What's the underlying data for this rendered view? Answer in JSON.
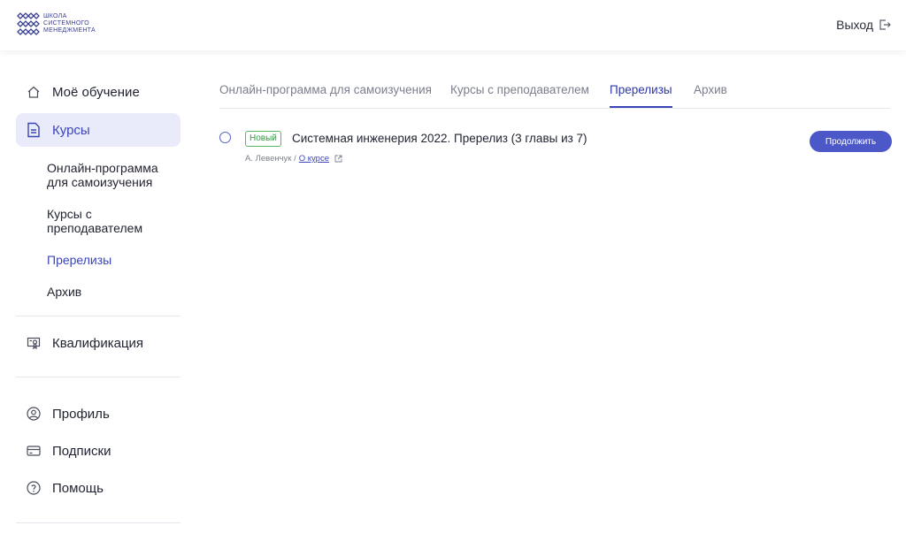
{
  "header": {
    "logo_text": "ШКОЛА\nСИСТЕМНОГО\nМЕНЕДЖМЕНТА",
    "logout_label": "Выход"
  },
  "sidebar": {
    "items": [
      {
        "label": "Моё обучение",
        "icon": "home-icon"
      },
      {
        "label": "Курсы",
        "icon": "document-icon"
      }
    ],
    "subitems": [
      {
        "label": "Онлайн-программа для самоизучения"
      },
      {
        "label": "Курсы с преподавателем"
      },
      {
        "label": "Пререлизы"
      },
      {
        "label": "Архив"
      }
    ],
    "qualification": {
      "label": "Квалификация",
      "icon": "certificate-icon"
    },
    "bottom": [
      {
        "label": "Профиль",
        "icon": "user-circle-icon"
      },
      {
        "label": "Подписки",
        "icon": "card-icon"
      },
      {
        "label": "Помощь",
        "icon": "question-icon"
      }
    ]
  },
  "tabs": [
    {
      "label": "Онлайн-программа для самоизучения"
    },
    {
      "label": "Курсы с преподавателем"
    },
    {
      "label": "Пререлизы"
    },
    {
      "label": "Архив"
    }
  ],
  "course": {
    "badge": "Новый",
    "title": "Системная инженерия 2022. Пререлиз (3 главы из 7)",
    "author": "А. Левенчук /",
    "about_link": "О курсе",
    "continue_label": "Продолжить"
  },
  "colors": {
    "accent": "#3b45b8",
    "active_bg": "#e9ebfb",
    "badge_green": "#2e9b3e"
  }
}
